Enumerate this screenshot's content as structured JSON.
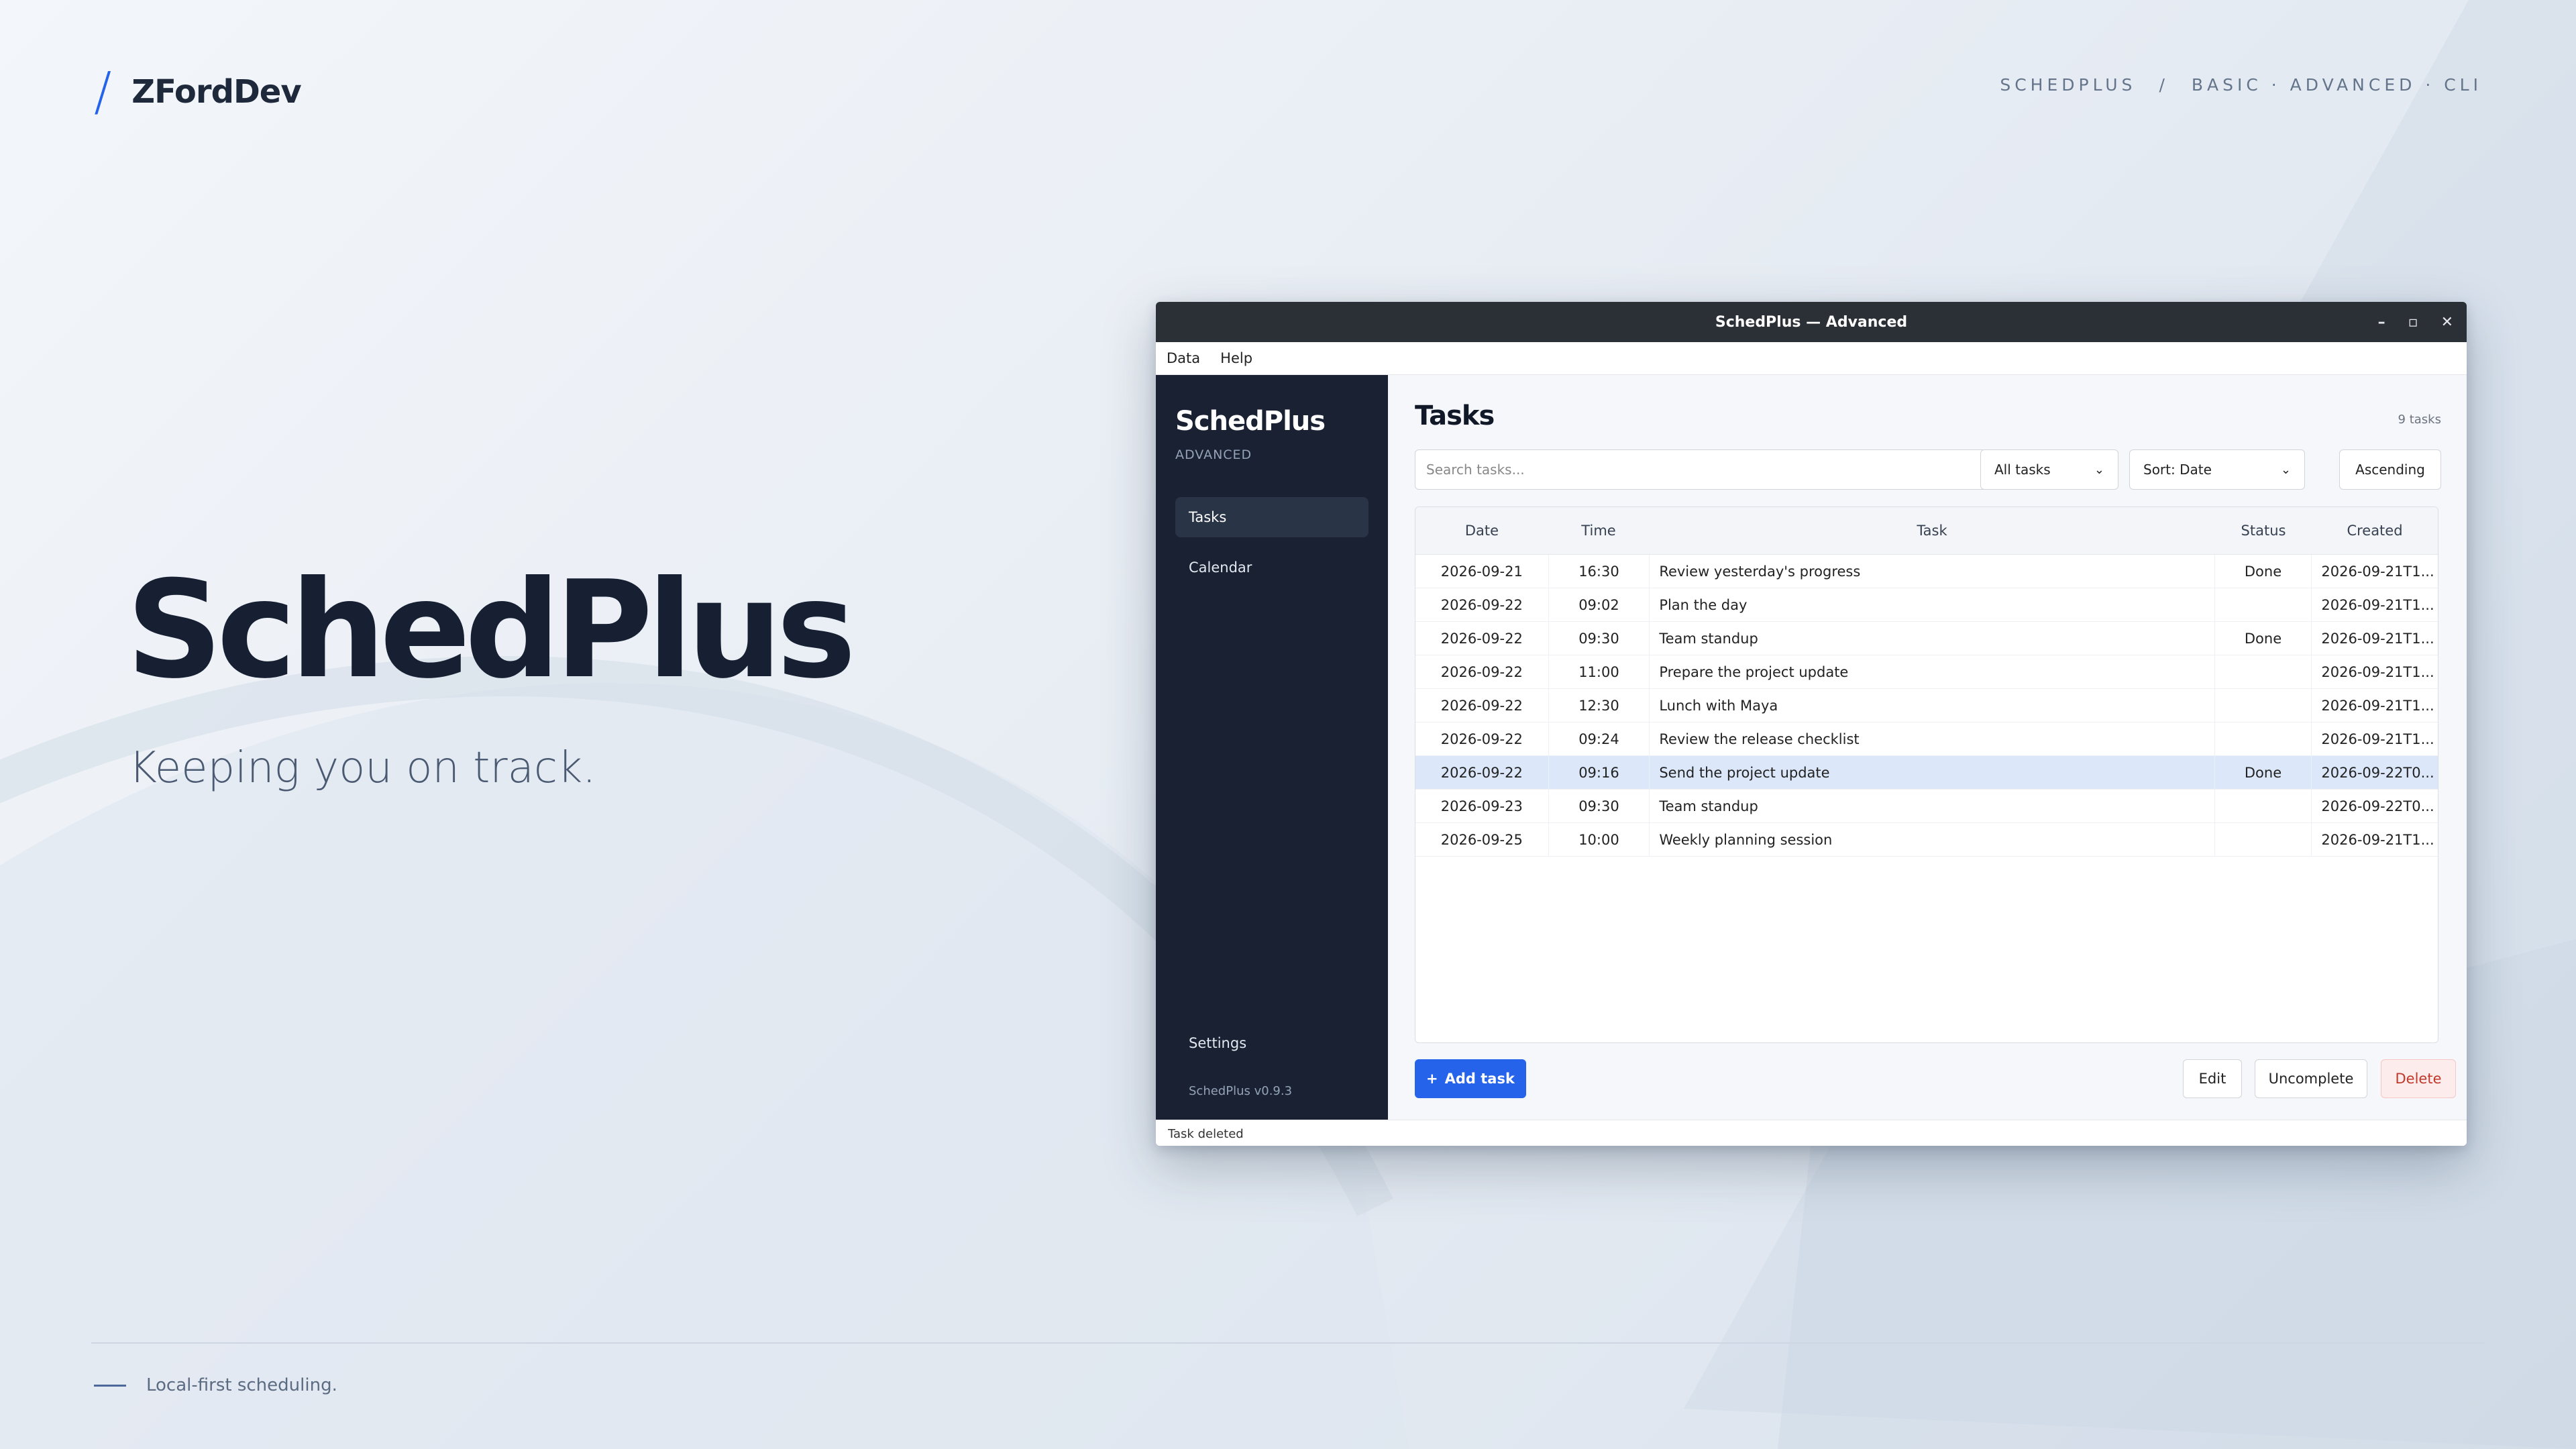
{
  "brand": {
    "slash": "/",
    "name": "ZFordDev"
  },
  "top_nav": {
    "product": "SCHEDPLUS",
    "separator": "/",
    "editions": "BASIC · ADVANCED · CLI"
  },
  "hero": {
    "title": "SchedPlus",
    "subtitle": "Keeping you on track."
  },
  "footer": {
    "text": "Local-first scheduling."
  },
  "colors": {
    "accent": "#2563eb",
    "sidebar": "#192133",
    "selected_row": "#dce8fa",
    "danger": "#c0392b"
  },
  "window": {
    "title": "SchedPlus — Advanced",
    "controls": {
      "minimize": "–",
      "maximize": "▫",
      "close": "✕"
    },
    "menu": [
      "Data",
      "Help"
    ],
    "sidebar": {
      "title": "SchedPlus",
      "subtitle": "ADVANCED",
      "items": [
        {
          "label": "Tasks",
          "active": true
        },
        {
          "label": "Calendar",
          "active": false
        }
      ],
      "settings_label": "Settings",
      "version": "SchedPlus v0.9.3"
    },
    "main": {
      "title": "Tasks",
      "count": "9 tasks",
      "search_placeholder": "Search tasks...",
      "filter_value": "All tasks",
      "sort_value": "Sort: Date",
      "order_label": "Ascending",
      "columns": [
        "Date",
        "Time",
        "Task",
        "Status",
        "Created"
      ],
      "rows": [
        {
          "date": "2026-09-21",
          "time": "16:30",
          "task": "Review yesterday's progress",
          "status": "Done",
          "created": "2026-09-21T1...",
          "selected": false
        },
        {
          "date": "2026-09-22",
          "time": "09:02",
          "task": "Plan the day",
          "status": "",
          "created": "2026-09-21T1...",
          "selected": false
        },
        {
          "date": "2026-09-22",
          "time": "09:30",
          "task": "Team standup",
          "status": "Done",
          "created": "2026-09-21T1...",
          "selected": false
        },
        {
          "date": "2026-09-22",
          "time": "11:00",
          "task": "Prepare the project update",
          "status": "",
          "created": "2026-09-21T1...",
          "selected": false
        },
        {
          "date": "2026-09-22",
          "time": "12:30",
          "task": "Lunch with Maya",
          "status": "",
          "created": "2026-09-21T1...",
          "selected": false
        },
        {
          "date": "2026-09-22",
          "time": "09:24",
          "task": "Review the release checklist",
          "status": "",
          "created": "2026-09-21T1...",
          "selected": false
        },
        {
          "date": "2026-09-22",
          "time": "09:16",
          "task": "Send the project update",
          "status": "Done",
          "created": "2026-09-22T0...",
          "selected": true
        },
        {
          "date": "2026-09-23",
          "time": "09:30",
          "task": "Team standup",
          "status": "",
          "created": "2026-09-22T0...",
          "selected": false
        },
        {
          "date": "2026-09-25",
          "time": "10:00",
          "task": "Weekly planning session",
          "status": "",
          "created": "2026-09-21T1...",
          "selected": false
        }
      ],
      "add_label": "Add task",
      "add_icon": "+",
      "edit_label": "Edit",
      "uncomplete_label": "Uncomplete",
      "delete_label": "Delete"
    },
    "status_text": "Task deleted"
  }
}
